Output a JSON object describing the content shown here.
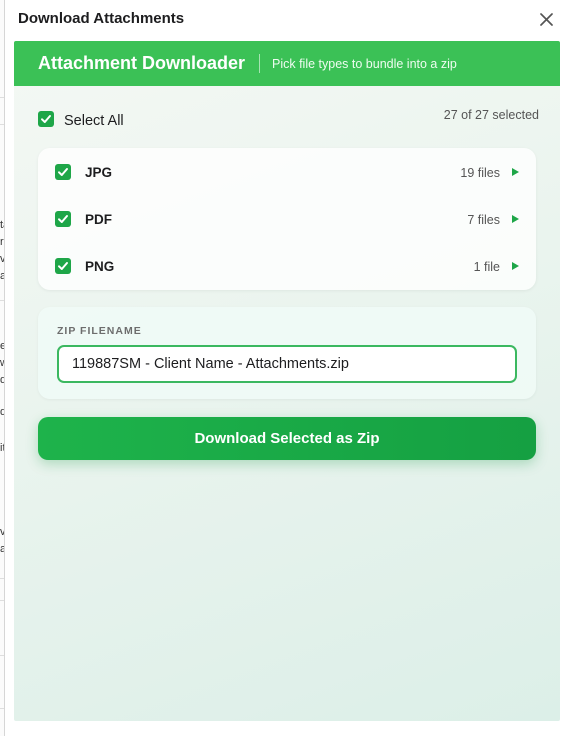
{
  "window": {
    "title": "Download Attachments"
  },
  "header": {
    "app_name": "Attachment Downloader",
    "tagline": "Pick file types to bundle into a zip"
  },
  "selection": {
    "select_all_label": "Select All",
    "select_all_checked": true,
    "summary": "27 of 27 selected"
  },
  "file_types": [
    {
      "name": "JPG",
      "count": "19 files",
      "checked": true
    },
    {
      "name": "PDF",
      "count": "7 files",
      "checked": true
    },
    {
      "name": "PNG",
      "count": "1 file",
      "checked": true
    }
  ],
  "zip": {
    "label": "ZIP FILENAME",
    "value": "119887SM - Client Name - Attachments.zip"
  },
  "actions": {
    "download_label": "Download Selected as Zip"
  },
  "background_fragments": [
    "ta",
    "r",
    "v",
    "at",
    "e",
    "wi",
    "q",
    "d",
    "it",
    "vo",
    "a"
  ],
  "colors": {
    "header_green": "#3bc156",
    "accent_green": "#1ea648",
    "button_green": "#1eb34b"
  },
  "icons": {
    "close": "close-icon",
    "checkbox": "checkmark-icon",
    "expand": "play-arrow-icon"
  }
}
